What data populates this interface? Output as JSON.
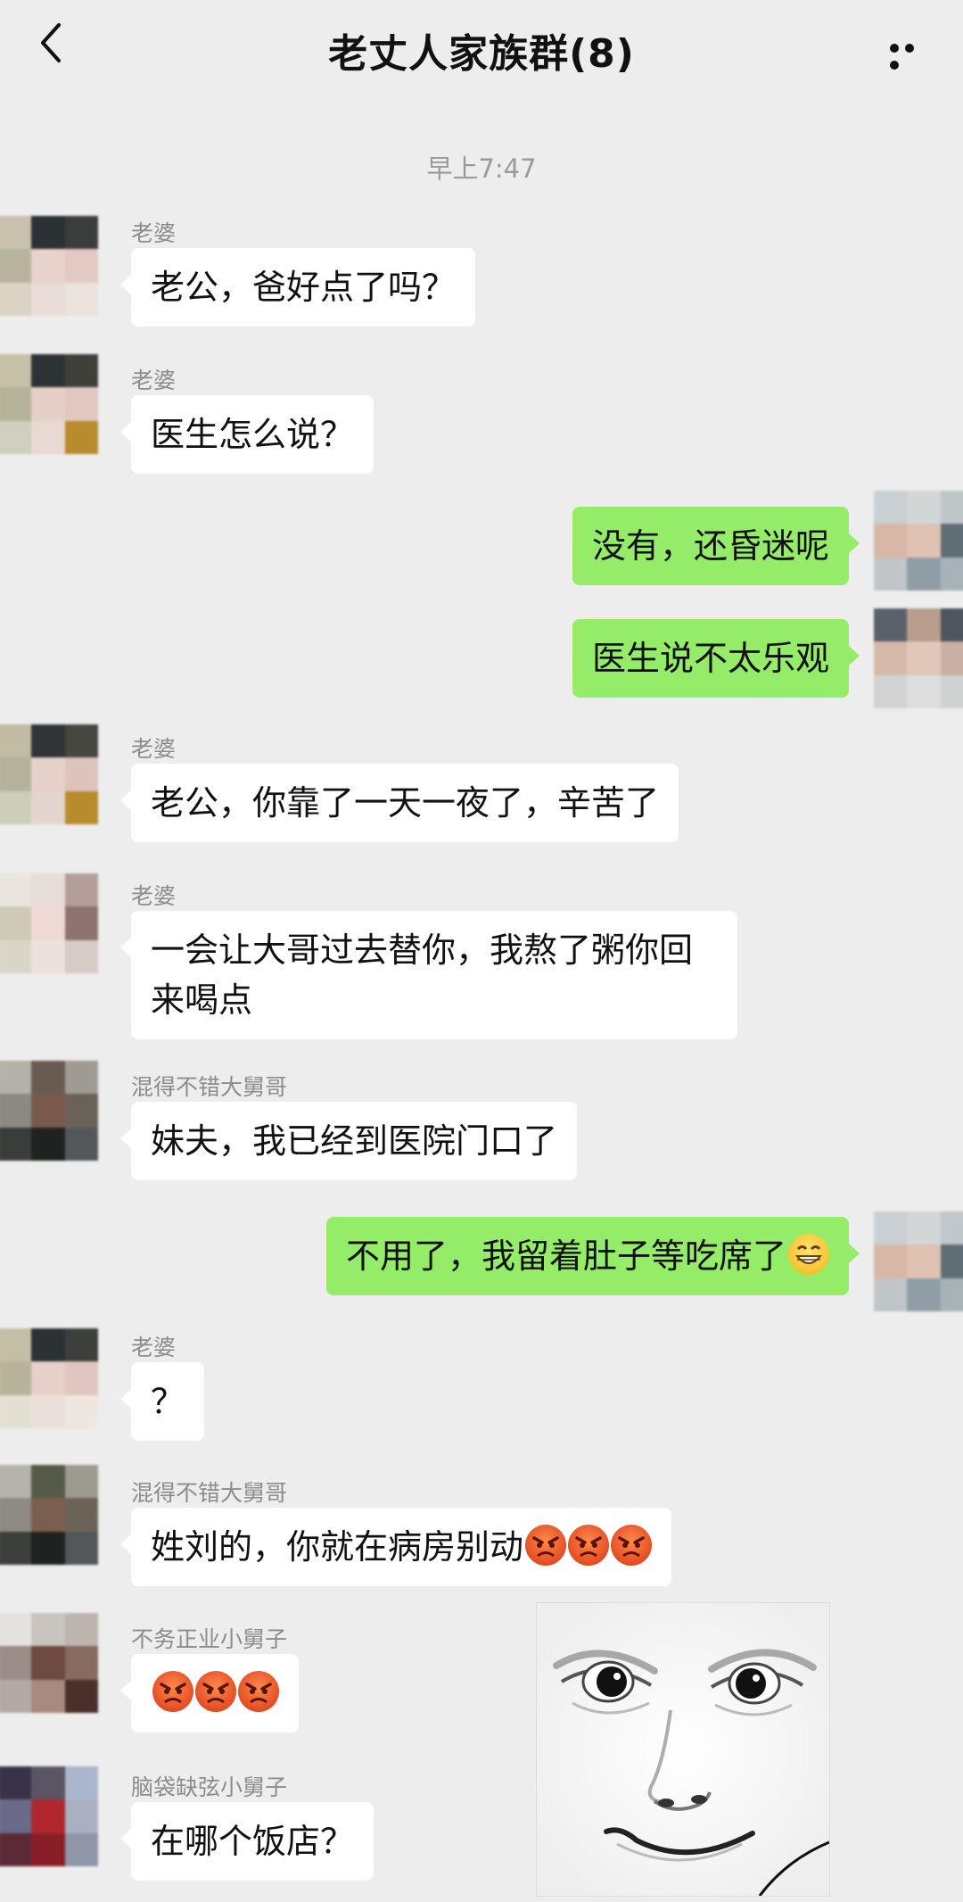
{
  "header": {
    "title": "老丈人家族群(8)"
  },
  "timestamp": "早上7:47",
  "messages": [
    {
      "sender": "老婆",
      "text": "老公，爸好点了吗？"
    },
    {
      "sender": "老婆",
      "text": "医生怎么说？"
    },
    {
      "sender": "",
      "text": "没有，还昏迷呢"
    },
    {
      "sender": "",
      "text": "医生说不太乐观"
    },
    {
      "sender": "老婆",
      "text": "老公，你靠了一天一夜了，辛苦了"
    },
    {
      "sender": "老婆",
      "text": "一会让大哥过去替你，我熬了粥你回来喝点"
    },
    {
      "sender": "混得不错大舅哥",
      "text": "妹夫，我已经到医院门口了"
    },
    {
      "sender": "",
      "text": "不用了，我留着肚子等吃席了"
    },
    {
      "sender": "老婆",
      "text": "？"
    },
    {
      "sender": "混得不错大舅哥",
      "text": "姓刘的，你就在病房别动"
    },
    {
      "sender": "不务正业小舅子",
      "text": ""
    },
    {
      "sender": "脑袋缺弦小舅子",
      "text": "在哪个饭店？"
    }
  ],
  "icons": {
    "back": "chevron-left-icon",
    "more": "more-dots-icon",
    "grin_emoji": "grin-emoji-icon",
    "angry_emoji": "angry-emoji-icon"
  },
  "colors": {
    "background": "#ededed",
    "outgoing_bubble": "#95ec69",
    "incoming_bubble": "#ffffff"
  }
}
